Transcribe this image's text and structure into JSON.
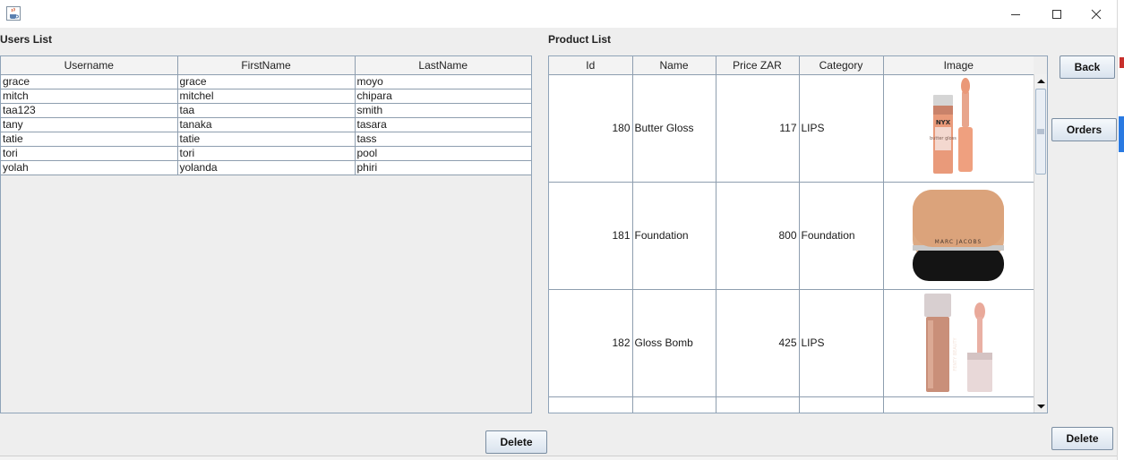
{
  "window": {
    "icon": "java-cup-icon",
    "controls": [
      "minimize-icon",
      "maximize-icon",
      "close-icon"
    ]
  },
  "users_panel": {
    "title": "Users List",
    "columns": [
      "Username",
      "FirstName",
      "LastName"
    ],
    "rows": [
      [
        "grace",
        "grace",
        "moyo"
      ],
      [
        "mitch",
        "mitchel",
        "chipara"
      ],
      [
        "taa123",
        "taa",
        "smith"
      ],
      [
        "tany",
        "tanaka",
        "tasara"
      ],
      [
        "tatie",
        "tatie",
        "tass"
      ],
      [
        "tori",
        "tori",
        "pool"
      ],
      [
        "yolah",
        "yolanda",
        "phiri"
      ]
    ],
    "delete_label": "Delete"
  },
  "products_panel": {
    "title": "Product List",
    "columns": [
      "Id",
      "Name",
      "Price ZAR",
      "Category",
      "Image"
    ],
    "rows": [
      {
        "id": "180",
        "name": "Butter Gloss",
        "price": "117",
        "category": "LIPS",
        "image": "lip-gloss-tube"
      },
      {
        "id": "181",
        "name": "Foundation",
        "price": "800",
        "category": "Foundation",
        "image": "foundation-compact"
      },
      {
        "id": "182",
        "name": "Gloss Bomb",
        "price": "425",
        "category": "LIPS",
        "image": "gloss-bomb-tube"
      }
    ],
    "image_texts": {
      "nyx_brand": "NYX",
      "butter_text": "butter gloss",
      "marc_text": "MARC JACOBS",
      "fenty_text": "FENTY BEAUTY"
    },
    "delete_label": "Delete"
  },
  "actions": {
    "back_label": "Back",
    "orders_label": "Orders"
  },
  "colors": {
    "accent_blue": "#2a7ae2",
    "grid_line": "#8e9eaf",
    "panel_bg": "#eeeeee"
  }
}
